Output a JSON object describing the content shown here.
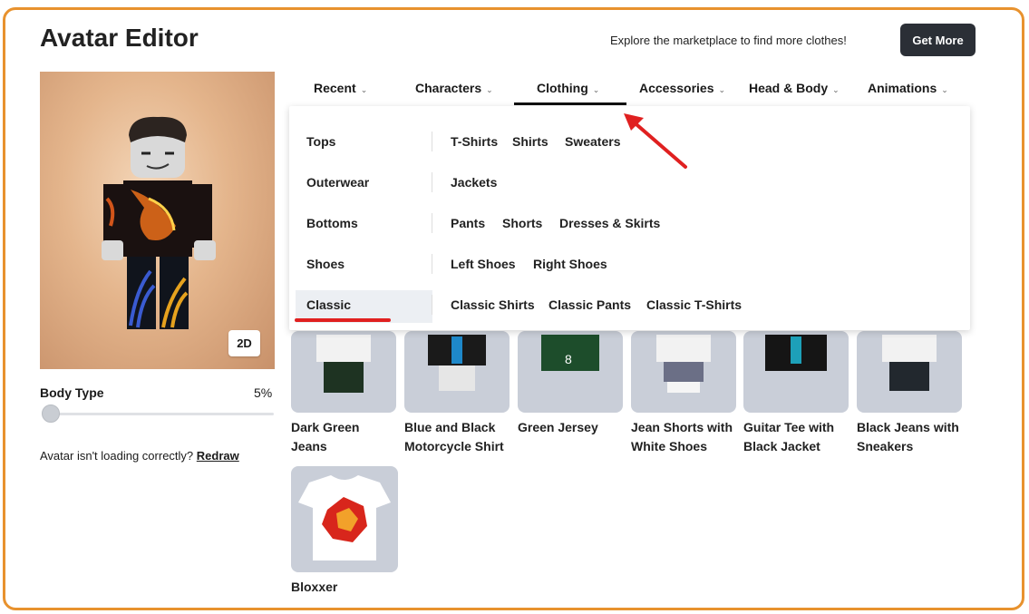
{
  "header": {
    "title": "Avatar Editor",
    "promo_text": "Explore the marketplace to find more clothes!",
    "get_more_label": "Get More"
  },
  "avatar": {
    "view_toggle_label": "2D",
    "body_type_label": "Body Type",
    "body_type_value": "5%",
    "body_type_fraction": 0.05,
    "loading_issue_text": "Avatar isn't loading correctly?",
    "redraw_label": "Redraw"
  },
  "tabs": [
    {
      "label": "Recent",
      "active": false
    },
    {
      "label": "Characters",
      "active": false
    },
    {
      "label": "Clothing",
      "active": true
    },
    {
      "label": "Accessories",
      "active": false
    },
    {
      "label": "Head & Body",
      "active": false
    },
    {
      "label": "Animations",
      "active": false
    }
  ],
  "clothing_menu": [
    {
      "category": "Tops",
      "items": [
        "T-Shirts",
        "Shirts",
        "Sweaters"
      ]
    },
    {
      "category": "Outerwear",
      "items": [
        "Jackets"
      ]
    },
    {
      "category": "Bottoms",
      "items": [
        "Pants",
        "Shorts",
        "Dresses & Skirts"
      ]
    },
    {
      "category": "Shoes",
      "items": [
        "Left Shoes",
        "Right Shoes"
      ]
    },
    {
      "category": "Classic",
      "items": [
        "Classic Shirts",
        "Classic Pants",
        "Classic T-Shirts"
      ],
      "selected": true
    }
  ],
  "items": [
    {
      "name_line1": "Dark Green",
      "name_line2": "Jeans"
    },
    {
      "name_line1": "Blue and Black",
      "name_line2": "Motorcycle Shirt"
    },
    {
      "name_line1": "Green Jersey",
      "name_line2": ""
    },
    {
      "name_line1": "Jean Shorts with",
      "name_line2": "White Shoes"
    },
    {
      "name_line1": "Guitar Tee with",
      "name_line2": "Black Jacket"
    },
    {
      "name_line1": "Black Jeans with",
      "name_line2": "Sneakers"
    },
    {
      "name_line1": "Bloxxer",
      "name_line2": ""
    }
  ],
  "colors": {
    "frame_border": "#e8922e",
    "button_dark": "#2b2f36",
    "annotation_red": "#e02020"
  }
}
